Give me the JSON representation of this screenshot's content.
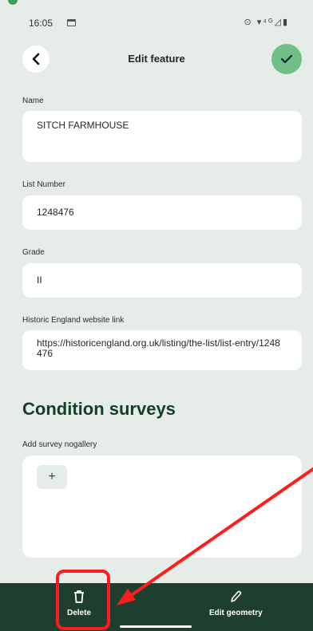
{
  "status": {
    "time": "16:05",
    "icons": "⊙ ▾⁴ᴳ◿▮"
  },
  "header": {
    "title": "Edit feature"
  },
  "fields": [
    {
      "label": "Name",
      "value": "SITCH FARMHOUSE"
    },
    {
      "label": "List Number",
      "value": "1248476"
    },
    {
      "label": "Grade",
      "value": "II"
    },
    {
      "label": "Historic England website link",
      "value": "https://historicengland.org.uk/listing/the-list/list-entry/1248476"
    }
  ],
  "conditions": {
    "title": "Condition surveys",
    "gallery_label": "Add survey nogallery",
    "add_label": "+"
  },
  "bottom": {
    "delete_label": "Delete",
    "edit_geometry_label": "Edit geometry"
  },
  "colors": {
    "accent": "#6fbf86",
    "bottom_bar": "#1e3f30",
    "annotation": "#ff1c1c"
  }
}
